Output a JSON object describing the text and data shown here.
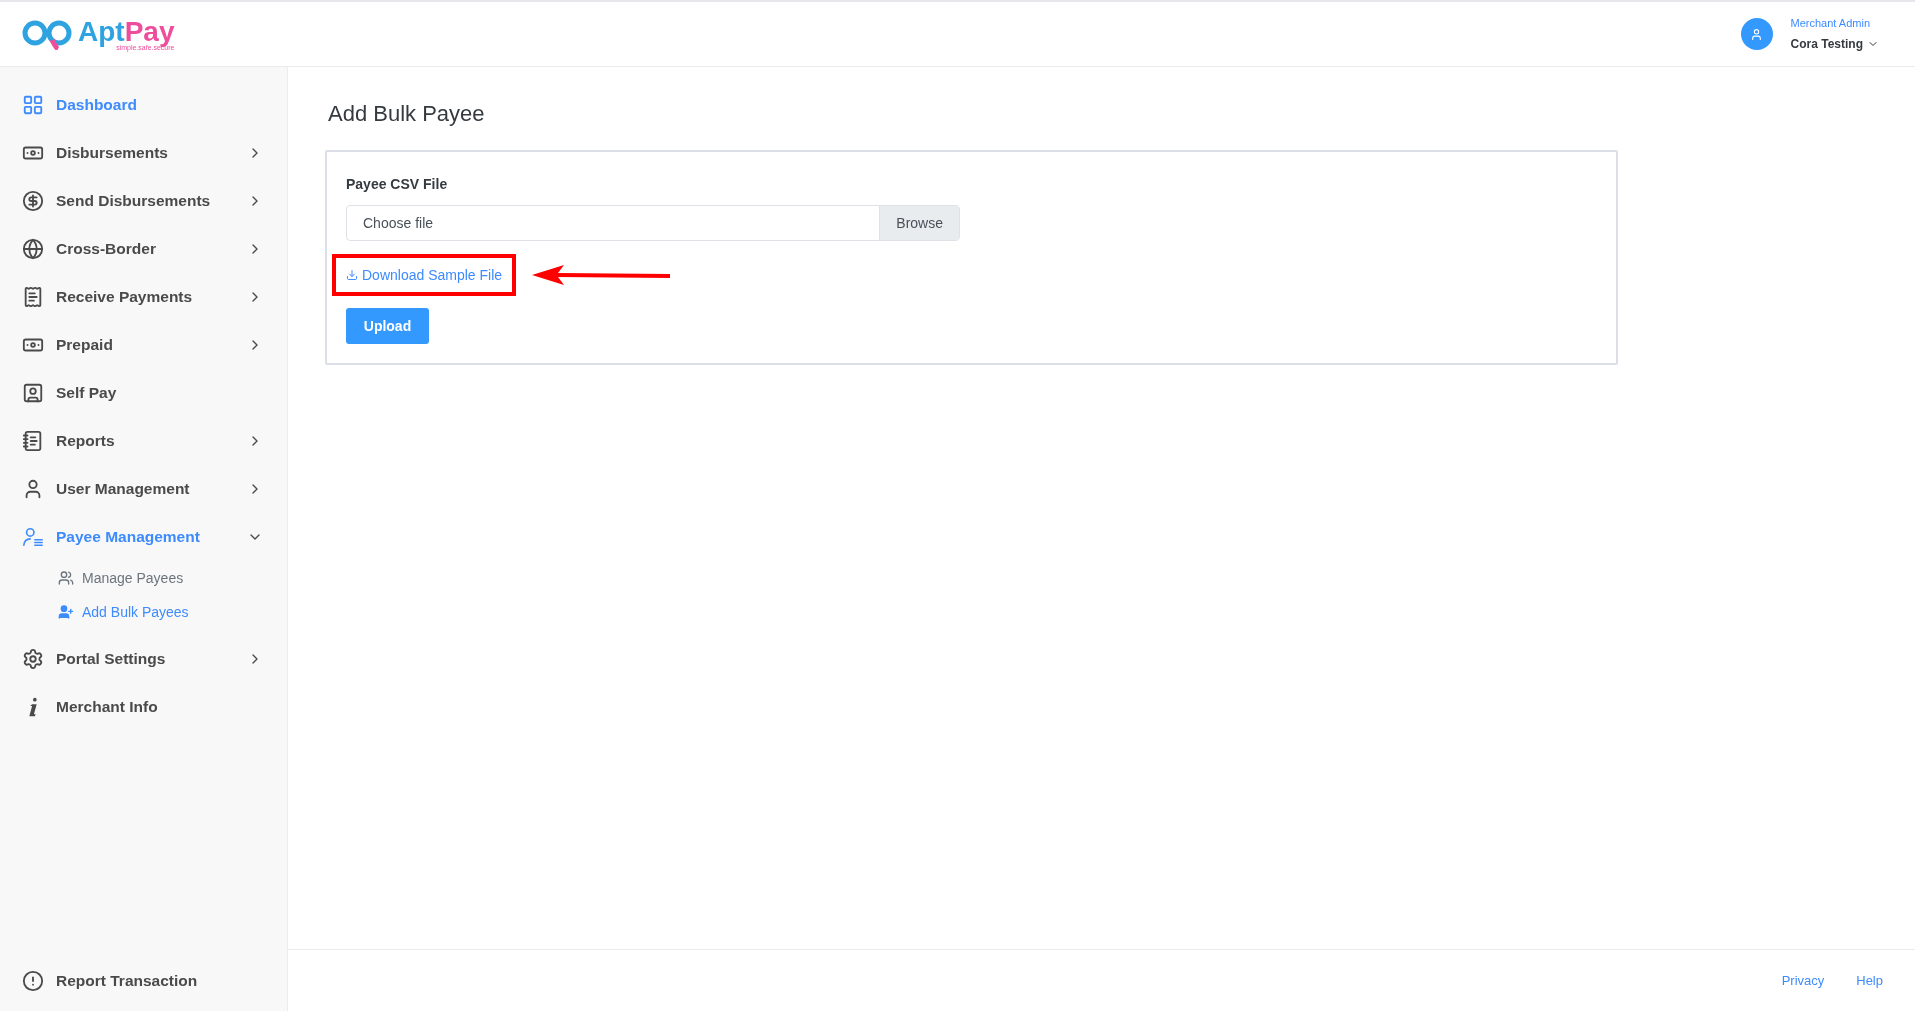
{
  "logo": {
    "name_part_1": "Apt",
    "name_part_2": "Pay",
    "tagline": "simple.safe.secure"
  },
  "user": {
    "role": "Merchant Admin",
    "name": "Cora Testing"
  },
  "sidebar": {
    "items": [
      {
        "label": "Dashboard",
        "kind": "link",
        "selected": true
      },
      {
        "label": "Disbursements",
        "kind": "group",
        "selected": false,
        "expanded": false
      },
      {
        "label": "Send Disbursements",
        "kind": "group",
        "selected": false,
        "expanded": false
      },
      {
        "label": "Cross-Border",
        "kind": "group",
        "selected": false,
        "expanded": false
      },
      {
        "label": "Receive Payments",
        "kind": "group",
        "selected": false,
        "expanded": false
      },
      {
        "label": "Prepaid",
        "kind": "group",
        "selected": false,
        "expanded": false
      },
      {
        "label": "Self Pay",
        "kind": "link",
        "selected": false
      },
      {
        "label": "Reports",
        "kind": "group",
        "selected": false,
        "expanded": false
      },
      {
        "label": "User Management",
        "kind": "group",
        "selected": false,
        "expanded": false
      },
      {
        "label": "Payee Management",
        "kind": "group",
        "selected": true,
        "expanded": true,
        "children": [
          {
            "label": "Manage Payees",
            "selected": false
          },
          {
            "label": "Add Bulk Payees",
            "selected": true
          }
        ]
      },
      {
        "label": "Portal Settings",
        "kind": "group",
        "selected": false,
        "expanded": false
      },
      {
        "label": "Merchant Info",
        "kind": "link",
        "selected": false
      }
    ],
    "bottom_item": {
      "label": "Report Transaction"
    }
  },
  "page": {
    "title": "Add Bulk Payee",
    "form": {
      "field_label": "Payee CSV File",
      "file_placeholder": "Choose file",
      "browse_button": "Browse",
      "download_link": "Download Sample File",
      "upload_button": "Upload"
    }
  },
  "footer": {
    "links": [
      "Privacy",
      "Help"
    ]
  }
}
